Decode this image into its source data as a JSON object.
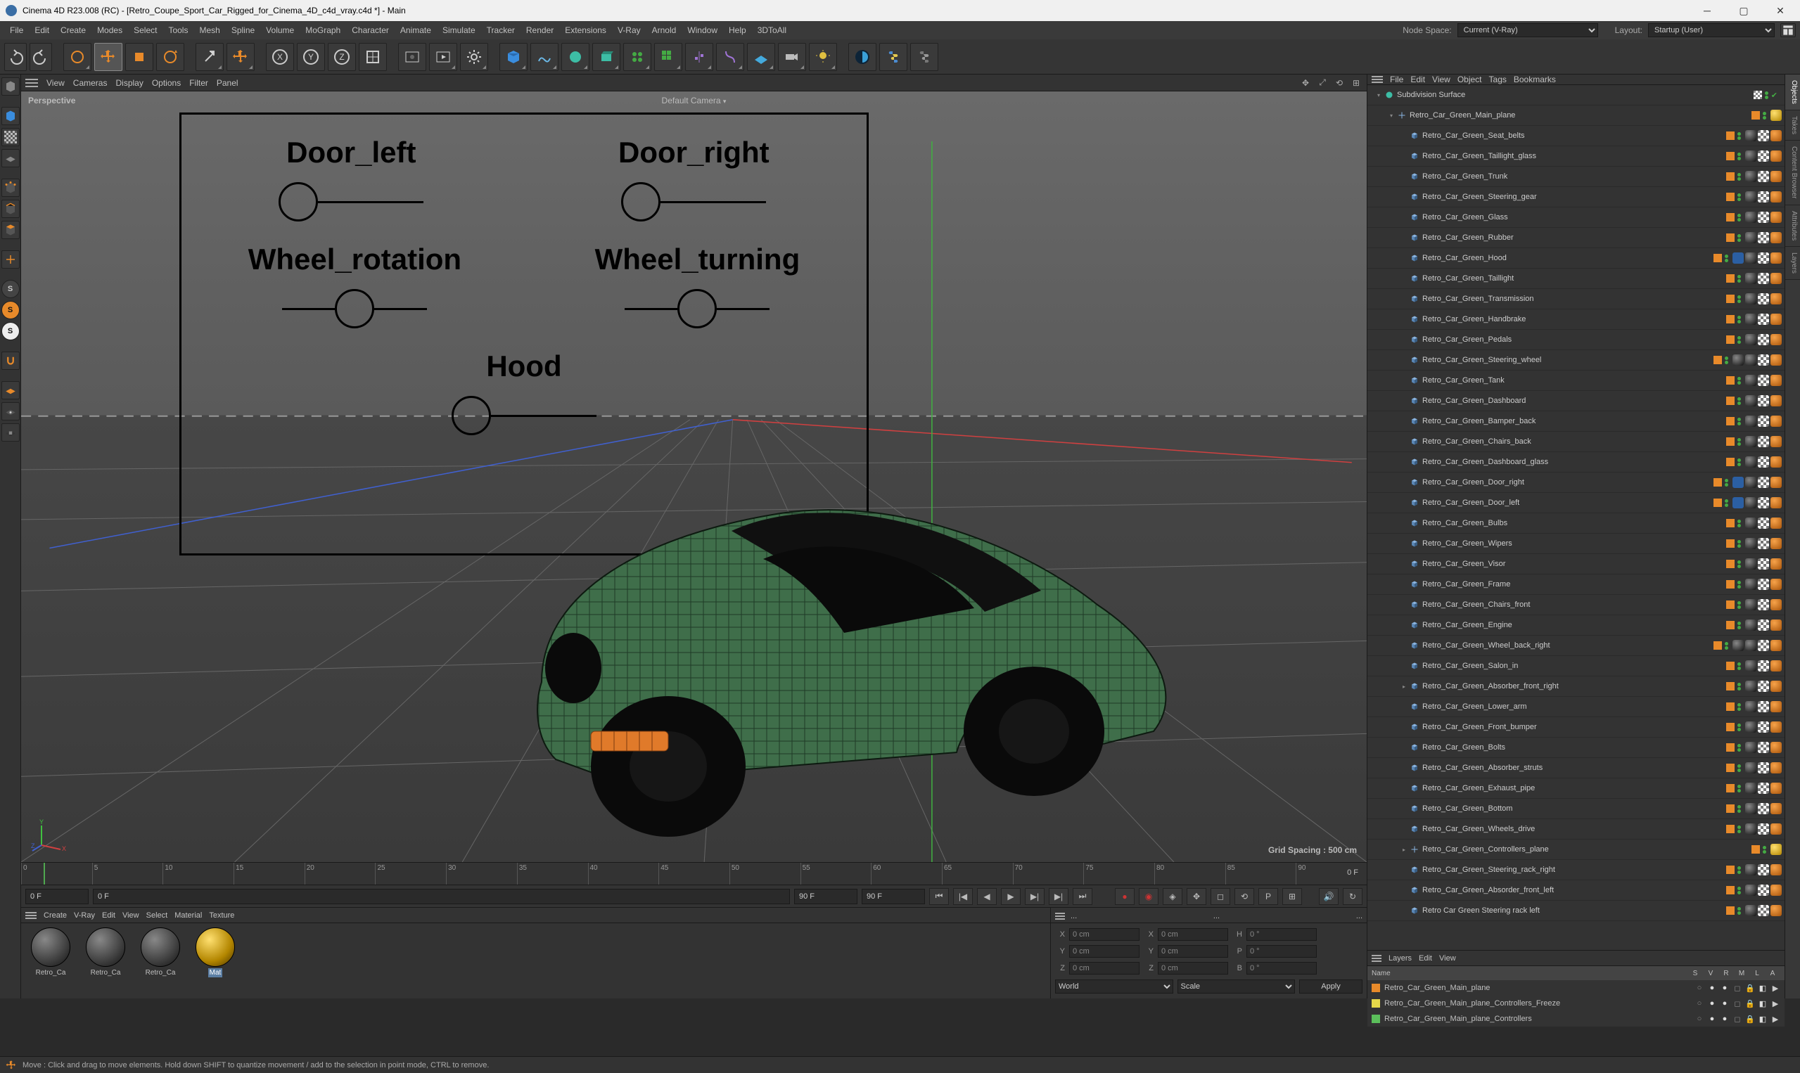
{
  "titlebar": {
    "text": "Cinema 4D R23.008 (RC) - [Retro_Coupe_Sport_Car_Rigged_for_Cinema_4D_c4d_vray.c4d *] - Main"
  },
  "menubar": {
    "items": [
      "File",
      "Edit",
      "Create",
      "Modes",
      "Select",
      "Tools",
      "Mesh",
      "Spline",
      "Volume",
      "MoGraph",
      "Character",
      "Animate",
      "Simulate",
      "Tracker",
      "Render",
      "Extensions",
      "V-Ray",
      "Arnold",
      "Window",
      "Help",
      "3DToAll"
    ],
    "node_space_label": "Node Space:",
    "node_space_value": "Current (V-Ray)",
    "layout_label": "Layout:",
    "layout_value": "Startup (User)"
  },
  "viewmenu": {
    "items": [
      "View",
      "Cameras",
      "Display",
      "Options",
      "Filter",
      "Panel"
    ]
  },
  "viewport": {
    "perspective": "Perspective",
    "default_camera": "Default Camera",
    "grid_spacing": "Grid Spacing : 500 cm",
    "hud": [
      {
        "label": "Door_left"
      },
      {
        "label": "Door_right"
      },
      {
        "label": "Wheel_rotation"
      },
      {
        "label": "Wheel_turning"
      },
      {
        "label": "Hood"
      }
    ]
  },
  "timeline": {
    "start": 0,
    "end": 90,
    "step": 5,
    "current_label": "0 F",
    "field_start": "0 F",
    "field_cur": "0 F",
    "field_end1": "90 F",
    "field_end2": "90 F"
  },
  "matmenu": {
    "items": [
      "Create",
      "V-Ray",
      "Edit",
      "View",
      "Select",
      "Material",
      "Texture"
    ]
  },
  "materials": [
    {
      "name": "Retro_Ca",
      "gold": false
    },
    {
      "name": "Retro_Ca",
      "gold": false
    },
    {
      "name": "Retro_Ca",
      "gold": false
    },
    {
      "name": "Mat",
      "gold": true,
      "selected": true
    }
  ],
  "coord": {
    "menuitems": [
      "...",
      "....",
      "....."
    ],
    "rows": [
      {
        "a": "X",
        "av": "0 cm",
        "b": "X",
        "bv": "0 cm",
        "c": "H",
        "cv": "0 °"
      },
      {
        "a": "Y",
        "av": "0 cm",
        "b": "Y",
        "bv": "0 cm",
        "c": "P",
        "cv": "0 °"
      },
      {
        "a": "Z",
        "av": "0 cm",
        "b": "Z",
        "bv": "0 cm",
        "c": "B",
        "cv": "0 °"
      }
    ],
    "world": "World",
    "scale": "Scale",
    "apply": "Apply"
  },
  "objmenu": {
    "items": [
      "File",
      "Edit",
      "View",
      "Object",
      "Tags",
      "Bookmarks"
    ]
  },
  "objects": [
    {
      "name": "Subdivision Surface",
      "depth": 0,
      "icon": "subdiv",
      "exp": "-",
      "layer": "none",
      "dots": [
        "gr",
        "gr"
      ],
      "tags": [],
      "check": true
    },
    {
      "name": "Retro_Car_Green_Main_plane",
      "depth": 1,
      "icon": "null",
      "exp": "-",
      "layer": "orange",
      "dots": [
        "gr",
        "gr"
      ],
      "tags": [
        "gold"
      ]
    },
    {
      "name": "Retro_Car_Green_Seat_belts",
      "depth": 2,
      "icon": "poly",
      "exp": "",
      "layer": "orange",
      "dots": [
        "gr",
        "gr"
      ],
      "tags": [
        "sphere",
        "check",
        "orange"
      ]
    },
    {
      "name": "Retro_Car_Green_Taillight_glass",
      "depth": 2,
      "icon": "poly",
      "exp": "",
      "layer": "orange",
      "dots": [
        "gr",
        "gr"
      ],
      "tags": [
        "sphere",
        "check",
        "orange"
      ]
    },
    {
      "name": "Retro_Car_Green_Trunk",
      "depth": 2,
      "icon": "poly",
      "exp": "",
      "layer": "orange",
      "dots": [
        "gr",
        "gr"
      ],
      "tags": [
        "sphere",
        "check",
        "orange"
      ]
    },
    {
      "name": "Retro_Car_Green_Steering_gear",
      "depth": 2,
      "icon": "poly",
      "exp": "",
      "layer": "orange",
      "dots": [
        "gr",
        "gr"
      ],
      "tags": [
        "sphere",
        "check",
        "orange"
      ]
    },
    {
      "name": "Retro_Car_Green_Glass",
      "depth": 2,
      "icon": "poly",
      "exp": "",
      "layer": "orange",
      "dots": [
        "gr",
        "gr"
      ],
      "tags": [
        "sphere",
        "check",
        "orange"
      ]
    },
    {
      "name": "Retro_Car_Green_Rubber",
      "depth": 2,
      "icon": "poly",
      "exp": "",
      "layer": "orange",
      "dots": [
        "gr",
        "gr"
      ],
      "tags": [
        "sphere",
        "check",
        "orange"
      ]
    },
    {
      "name": "Retro_Car_Green_Hood",
      "depth": 2,
      "icon": "poly",
      "exp": "",
      "layer": "orange",
      "dots": [
        "gr",
        "gr"
      ],
      "tags": [
        "blue",
        "sphere",
        "check",
        "orange"
      ]
    },
    {
      "name": "Retro_Car_Green_Taillight",
      "depth": 2,
      "icon": "poly",
      "exp": "",
      "layer": "orange",
      "dots": [
        "gr",
        "gr"
      ],
      "tags": [
        "sphere",
        "check",
        "orange"
      ]
    },
    {
      "name": "Retro_Car_Green_Transmission",
      "depth": 2,
      "icon": "poly",
      "exp": "",
      "layer": "orange",
      "dots": [
        "gr",
        "gr"
      ],
      "tags": [
        "sphere",
        "check",
        "orange"
      ]
    },
    {
      "name": "Retro_Car_Green_Handbrake",
      "depth": 2,
      "icon": "poly",
      "exp": "",
      "layer": "orange",
      "dots": [
        "gr",
        "gr"
      ],
      "tags": [
        "sphere",
        "check",
        "orange"
      ]
    },
    {
      "name": "Retro_Car_Green_Pedals",
      "depth": 2,
      "icon": "poly",
      "exp": "",
      "layer": "orange",
      "dots": [
        "gr",
        "gr"
      ],
      "tags": [
        "sphere",
        "check",
        "orange"
      ]
    },
    {
      "name": "Retro_Car_Green_Steering_wheel",
      "depth": 2,
      "icon": "poly",
      "exp": "",
      "layer": "orange",
      "dots": [
        "gr",
        "gr"
      ],
      "tags": [
        "sphere",
        "sphere",
        "check",
        "orange"
      ]
    },
    {
      "name": "Retro_Car_Green_Tank",
      "depth": 2,
      "icon": "poly",
      "exp": "",
      "layer": "orange",
      "dots": [
        "gr",
        "gr"
      ],
      "tags": [
        "sphere",
        "check",
        "orange"
      ]
    },
    {
      "name": "Retro_Car_Green_Dashboard",
      "depth": 2,
      "icon": "poly",
      "exp": "",
      "layer": "orange",
      "dots": [
        "gr",
        "gr"
      ],
      "tags": [
        "sphere",
        "check",
        "orange"
      ]
    },
    {
      "name": "Retro_Car_Green_Bamper_back",
      "depth": 2,
      "icon": "poly",
      "exp": "",
      "layer": "orange",
      "dots": [
        "gr",
        "gr"
      ],
      "tags": [
        "sphere",
        "check",
        "orange"
      ]
    },
    {
      "name": "Retro_Car_Green_Chairs_back",
      "depth": 2,
      "icon": "poly",
      "exp": "",
      "layer": "orange",
      "dots": [
        "gr",
        "gr"
      ],
      "tags": [
        "sphere",
        "check",
        "orange"
      ]
    },
    {
      "name": "Retro_Car_Green_Dashboard_glass",
      "depth": 2,
      "icon": "poly",
      "exp": "",
      "layer": "orange",
      "dots": [
        "gr",
        "gr"
      ],
      "tags": [
        "sphere",
        "check",
        "orange"
      ]
    },
    {
      "name": "Retro_Car_Green_Door_right",
      "depth": 2,
      "icon": "poly",
      "exp": "",
      "layer": "orange",
      "dots": [
        "gr",
        "gr"
      ],
      "tags": [
        "blue",
        "sphere",
        "check",
        "orange"
      ]
    },
    {
      "name": "Retro_Car_Green_Door_left",
      "depth": 2,
      "icon": "poly",
      "exp": "",
      "layer": "orange",
      "dots": [
        "gr",
        "gr"
      ],
      "tags": [
        "blue",
        "sphere",
        "check",
        "orange"
      ]
    },
    {
      "name": "Retro_Car_Green_Bulbs",
      "depth": 2,
      "icon": "poly",
      "exp": "",
      "layer": "orange",
      "dots": [
        "gr",
        "gr"
      ],
      "tags": [
        "sphere",
        "check",
        "orange"
      ]
    },
    {
      "name": "Retro_Car_Green_Wipers",
      "depth": 2,
      "icon": "poly",
      "exp": "",
      "layer": "orange",
      "dots": [
        "gr",
        "gr"
      ],
      "tags": [
        "sphere",
        "check",
        "orange"
      ]
    },
    {
      "name": "Retro_Car_Green_Visor",
      "depth": 2,
      "icon": "poly",
      "exp": "",
      "layer": "orange",
      "dots": [
        "gr",
        "gr"
      ],
      "tags": [
        "sphere",
        "check",
        "orange"
      ]
    },
    {
      "name": "Retro_Car_Green_Frame",
      "depth": 2,
      "icon": "poly",
      "exp": "",
      "layer": "orange",
      "dots": [
        "gr",
        "gr"
      ],
      "tags": [
        "sphere",
        "check",
        "orange"
      ]
    },
    {
      "name": "Retro_Car_Green_Chairs_front",
      "depth": 2,
      "icon": "poly",
      "exp": "",
      "layer": "orange",
      "dots": [
        "gr",
        "gr"
      ],
      "tags": [
        "sphere",
        "check",
        "orange"
      ]
    },
    {
      "name": "Retro_Car_Green_Engine",
      "depth": 2,
      "icon": "poly",
      "exp": "",
      "layer": "orange",
      "dots": [
        "gr",
        "gr"
      ],
      "tags": [
        "sphere",
        "check",
        "orange"
      ]
    },
    {
      "name": "Retro_Car_Green_Wheel_back_right",
      "depth": 2,
      "icon": "poly",
      "exp": "",
      "layer": "orange",
      "dots": [
        "gr",
        "gr"
      ],
      "tags": [
        "sphere",
        "sphere",
        "check",
        "orange"
      ]
    },
    {
      "name": "Retro_Car_Green_Salon_in",
      "depth": 2,
      "icon": "poly",
      "exp": "",
      "layer": "orange",
      "dots": [
        "gr",
        "gr"
      ],
      "tags": [
        "sphere",
        "check",
        "orange"
      ]
    },
    {
      "name": "Retro_Car_Green_Absorber_front_right",
      "depth": 2,
      "icon": "poly",
      "exp": "+",
      "layer": "orange",
      "dots": [
        "gr",
        "gr"
      ],
      "tags": [
        "sphere",
        "check",
        "orange"
      ]
    },
    {
      "name": "Retro_Car_Green_Lower_arm",
      "depth": 2,
      "icon": "poly",
      "exp": "",
      "layer": "orange",
      "dots": [
        "gr",
        "gr"
      ],
      "tags": [
        "sphere",
        "check",
        "orange"
      ]
    },
    {
      "name": "Retro_Car_Green_Front_bumper",
      "depth": 2,
      "icon": "poly",
      "exp": "",
      "layer": "orange",
      "dots": [
        "gr",
        "gr"
      ],
      "tags": [
        "sphere",
        "check",
        "orange"
      ]
    },
    {
      "name": "Retro_Car_Green_Bolts",
      "depth": 2,
      "icon": "poly",
      "exp": "",
      "layer": "orange",
      "dots": [
        "gr",
        "gr"
      ],
      "tags": [
        "sphere",
        "check",
        "orange"
      ]
    },
    {
      "name": "Retro_Car_Green_Absorber_struts",
      "depth": 2,
      "icon": "poly",
      "exp": "",
      "layer": "orange",
      "dots": [
        "gr",
        "gr"
      ],
      "tags": [
        "sphere",
        "check",
        "orange"
      ]
    },
    {
      "name": "Retro_Car_Green_Exhaust_pipe",
      "depth": 2,
      "icon": "poly",
      "exp": "",
      "layer": "orange",
      "dots": [
        "gr",
        "gr"
      ],
      "tags": [
        "sphere",
        "check",
        "orange"
      ]
    },
    {
      "name": "Retro_Car_Green_Bottom",
      "depth": 2,
      "icon": "poly",
      "exp": "",
      "layer": "orange",
      "dots": [
        "gr",
        "gr"
      ],
      "tags": [
        "sphere",
        "check",
        "orange"
      ]
    },
    {
      "name": "Retro_Car_Green_Wheels_drive",
      "depth": 2,
      "icon": "poly",
      "exp": "",
      "layer": "orange",
      "dots": [
        "gr",
        "gr"
      ],
      "tags": [
        "sphere",
        "check",
        "orange"
      ]
    },
    {
      "name": "Retro_Car_Green_Controllers_plane",
      "depth": 2,
      "icon": "null",
      "exp": "+",
      "layer": "orange",
      "dots": [
        "gr",
        "gr"
      ],
      "tags": [
        "gold"
      ]
    },
    {
      "name": "Retro_Car_Green_Steering_rack_right",
      "depth": 2,
      "icon": "poly",
      "exp": "",
      "layer": "orange",
      "dots": [
        "gr",
        "gr"
      ],
      "tags": [
        "sphere",
        "check",
        "orange"
      ]
    },
    {
      "name": "Retro_Car_Green_Absorder_front_left",
      "depth": 2,
      "icon": "poly",
      "exp": "",
      "layer": "orange",
      "dots": [
        "gr",
        "gr"
      ],
      "tags": [
        "sphere",
        "check",
        "orange"
      ]
    },
    {
      "name": "Retro Car Green Steering rack left",
      "depth": 2,
      "icon": "poly",
      "exp": "",
      "layer": "orange",
      "dots": [
        "gr",
        "gr"
      ],
      "tags": [
        "sphere",
        "check",
        "orange"
      ]
    }
  ],
  "attrmenu": {
    "items": [
      "Layers",
      "Edit",
      "View"
    ]
  },
  "attrhead": {
    "name": "Name",
    "cols": [
      "S",
      "V",
      "R",
      "M",
      "L",
      "A"
    ]
  },
  "attrrows": [
    {
      "color": "#e88a2a",
      "name": "Retro_Car_Green_Main_plane"
    },
    {
      "color": "#e6d84a",
      "name": "Retro_Car_Green_Main_plane_Controllers_Freeze"
    },
    {
      "color": "#5bbf5b",
      "name": "Retro_Car_Green_Main_plane_Controllers"
    }
  ],
  "rightstrip": [
    "Objects",
    "Takes",
    "Content Browser",
    "Attributes",
    "Layers"
  ],
  "statusbar": {
    "text": "Move : Click and drag to move elements. Hold down SHIFT to quantize movement / add to the selection in point mode, CTRL to remove."
  }
}
